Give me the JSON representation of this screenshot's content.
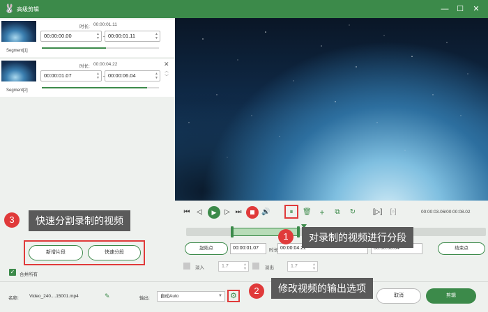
{
  "window": {
    "title": "高级剪辑",
    "minimize": "—",
    "maximize": "☐",
    "close": "✕",
    "logo": "🐰"
  },
  "segments": [
    {
      "name": "Segment[1]",
      "duration_label": "时长:",
      "duration": "00:00:01.11",
      "start": "00:00:00.00",
      "end": "00:00:01.11",
      "progress": 0.55
    },
    {
      "name": "Segment[2]",
      "duration_label": "时长:",
      "duration": "00:00:04.22",
      "start": "00:00:01.07",
      "end": "00:00:06.04",
      "progress": 0.9
    }
  ],
  "left_panel": {
    "new_segment": "新增片段",
    "fast_split": "快速分段",
    "merge_all": "合并所有"
  },
  "callouts": [
    {
      "num": "1",
      "text": "对录制的视频进行分段"
    },
    {
      "num": "2",
      "text": "修改视频的输出选项"
    },
    {
      "num": "3",
      "text": "快速分割录制的视频"
    }
  ],
  "player": {
    "time_readout": "00:00:03.06/00:00:08.02"
  },
  "trim": {
    "start_label": "起始点",
    "start_value": "00:00:01.07",
    "duration_label": "时长",
    "duration_value": "00:00:04.22",
    "end_value": "00:00:06.04",
    "end_label": "结束点"
  },
  "fade": {
    "in_label": "淡入",
    "in_value": "1.7",
    "out_label": "淡出",
    "out_value": "1.7"
  },
  "bottom": {
    "name_label": "名称:",
    "file_name": "Video_240....15001.mp4",
    "output_label": "输出:",
    "output_value": "自动Auto",
    "cancel": "取消",
    "edit": "剪辑"
  },
  "colors": {
    "accent": "#3c8a4a",
    "callout_bg": "#5a5a5a",
    "badge": "#e03a3a"
  }
}
